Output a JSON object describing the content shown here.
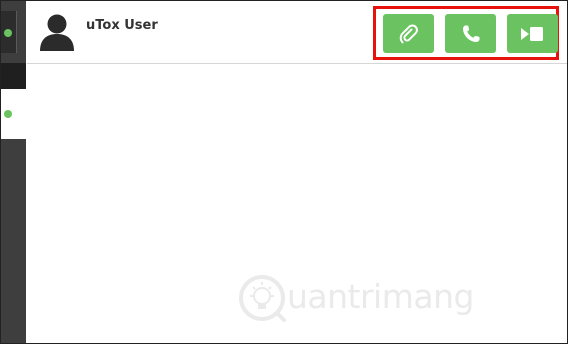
{
  "contact": {
    "name": "uTox User"
  },
  "sidebar": {
    "items": [
      {
        "status": "online",
        "status_color": "#6bc260"
      },
      {
        "status": "online",
        "status_color": "#6bc260"
      }
    ]
  },
  "toolbar": {
    "buttons": [
      {
        "name": "attach-file",
        "icon": "paperclip-icon"
      },
      {
        "name": "audio-call",
        "icon": "phone-icon"
      },
      {
        "name": "video-call",
        "icon": "video-camera-icon"
      }
    ],
    "button_color": "#6bc260",
    "highlight_color": "#e8120c"
  },
  "watermark": {
    "text": "uantrimang"
  }
}
